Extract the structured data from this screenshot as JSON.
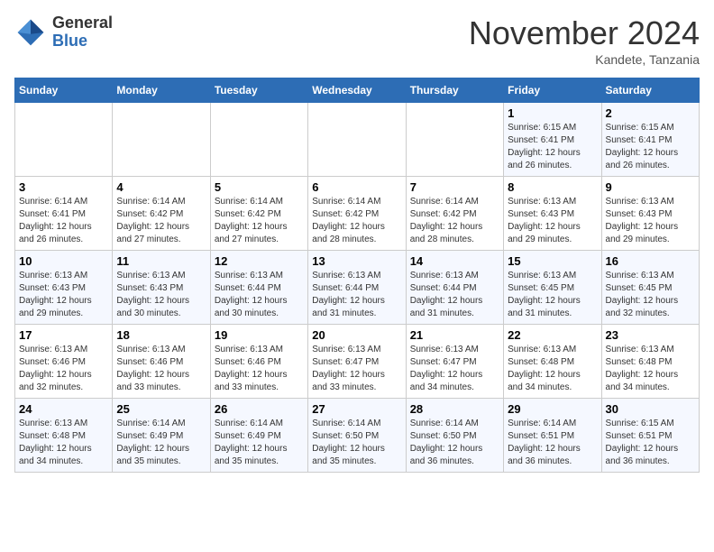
{
  "logo": {
    "general": "General",
    "blue": "Blue"
  },
  "title": "November 2024",
  "location": "Kandete, Tanzania",
  "days_of_week": [
    "Sunday",
    "Monday",
    "Tuesday",
    "Wednesday",
    "Thursday",
    "Friday",
    "Saturday"
  ],
  "weeks": [
    [
      {
        "num": "",
        "info": ""
      },
      {
        "num": "",
        "info": ""
      },
      {
        "num": "",
        "info": ""
      },
      {
        "num": "",
        "info": ""
      },
      {
        "num": "",
        "info": ""
      },
      {
        "num": "1",
        "info": "Sunrise: 6:15 AM\nSunset: 6:41 PM\nDaylight: 12 hours\nand 26 minutes."
      },
      {
        "num": "2",
        "info": "Sunrise: 6:15 AM\nSunset: 6:41 PM\nDaylight: 12 hours\nand 26 minutes."
      }
    ],
    [
      {
        "num": "3",
        "info": "Sunrise: 6:14 AM\nSunset: 6:41 PM\nDaylight: 12 hours\nand 26 minutes."
      },
      {
        "num": "4",
        "info": "Sunrise: 6:14 AM\nSunset: 6:42 PM\nDaylight: 12 hours\nand 27 minutes."
      },
      {
        "num": "5",
        "info": "Sunrise: 6:14 AM\nSunset: 6:42 PM\nDaylight: 12 hours\nand 27 minutes."
      },
      {
        "num": "6",
        "info": "Sunrise: 6:14 AM\nSunset: 6:42 PM\nDaylight: 12 hours\nand 28 minutes."
      },
      {
        "num": "7",
        "info": "Sunrise: 6:14 AM\nSunset: 6:42 PM\nDaylight: 12 hours\nand 28 minutes."
      },
      {
        "num": "8",
        "info": "Sunrise: 6:13 AM\nSunset: 6:43 PM\nDaylight: 12 hours\nand 29 minutes."
      },
      {
        "num": "9",
        "info": "Sunrise: 6:13 AM\nSunset: 6:43 PM\nDaylight: 12 hours\nand 29 minutes."
      }
    ],
    [
      {
        "num": "10",
        "info": "Sunrise: 6:13 AM\nSunset: 6:43 PM\nDaylight: 12 hours\nand 29 minutes."
      },
      {
        "num": "11",
        "info": "Sunrise: 6:13 AM\nSunset: 6:43 PM\nDaylight: 12 hours\nand 30 minutes."
      },
      {
        "num": "12",
        "info": "Sunrise: 6:13 AM\nSunset: 6:44 PM\nDaylight: 12 hours\nand 30 minutes."
      },
      {
        "num": "13",
        "info": "Sunrise: 6:13 AM\nSunset: 6:44 PM\nDaylight: 12 hours\nand 31 minutes."
      },
      {
        "num": "14",
        "info": "Sunrise: 6:13 AM\nSunset: 6:44 PM\nDaylight: 12 hours\nand 31 minutes."
      },
      {
        "num": "15",
        "info": "Sunrise: 6:13 AM\nSunset: 6:45 PM\nDaylight: 12 hours\nand 31 minutes."
      },
      {
        "num": "16",
        "info": "Sunrise: 6:13 AM\nSunset: 6:45 PM\nDaylight: 12 hours\nand 32 minutes."
      }
    ],
    [
      {
        "num": "17",
        "info": "Sunrise: 6:13 AM\nSunset: 6:46 PM\nDaylight: 12 hours\nand 32 minutes."
      },
      {
        "num": "18",
        "info": "Sunrise: 6:13 AM\nSunset: 6:46 PM\nDaylight: 12 hours\nand 33 minutes."
      },
      {
        "num": "19",
        "info": "Sunrise: 6:13 AM\nSunset: 6:46 PM\nDaylight: 12 hours\nand 33 minutes."
      },
      {
        "num": "20",
        "info": "Sunrise: 6:13 AM\nSunset: 6:47 PM\nDaylight: 12 hours\nand 33 minutes."
      },
      {
        "num": "21",
        "info": "Sunrise: 6:13 AM\nSunset: 6:47 PM\nDaylight: 12 hours\nand 34 minutes."
      },
      {
        "num": "22",
        "info": "Sunrise: 6:13 AM\nSunset: 6:48 PM\nDaylight: 12 hours\nand 34 minutes."
      },
      {
        "num": "23",
        "info": "Sunrise: 6:13 AM\nSunset: 6:48 PM\nDaylight: 12 hours\nand 34 minutes."
      }
    ],
    [
      {
        "num": "24",
        "info": "Sunrise: 6:13 AM\nSunset: 6:48 PM\nDaylight: 12 hours\nand 34 minutes."
      },
      {
        "num": "25",
        "info": "Sunrise: 6:14 AM\nSunset: 6:49 PM\nDaylight: 12 hours\nand 35 minutes."
      },
      {
        "num": "26",
        "info": "Sunrise: 6:14 AM\nSunset: 6:49 PM\nDaylight: 12 hours\nand 35 minutes."
      },
      {
        "num": "27",
        "info": "Sunrise: 6:14 AM\nSunset: 6:50 PM\nDaylight: 12 hours\nand 35 minutes."
      },
      {
        "num": "28",
        "info": "Sunrise: 6:14 AM\nSunset: 6:50 PM\nDaylight: 12 hours\nand 36 minutes."
      },
      {
        "num": "29",
        "info": "Sunrise: 6:14 AM\nSunset: 6:51 PM\nDaylight: 12 hours\nand 36 minutes."
      },
      {
        "num": "30",
        "info": "Sunrise: 6:15 AM\nSunset: 6:51 PM\nDaylight: 12 hours\nand 36 minutes."
      }
    ]
  ]
}
